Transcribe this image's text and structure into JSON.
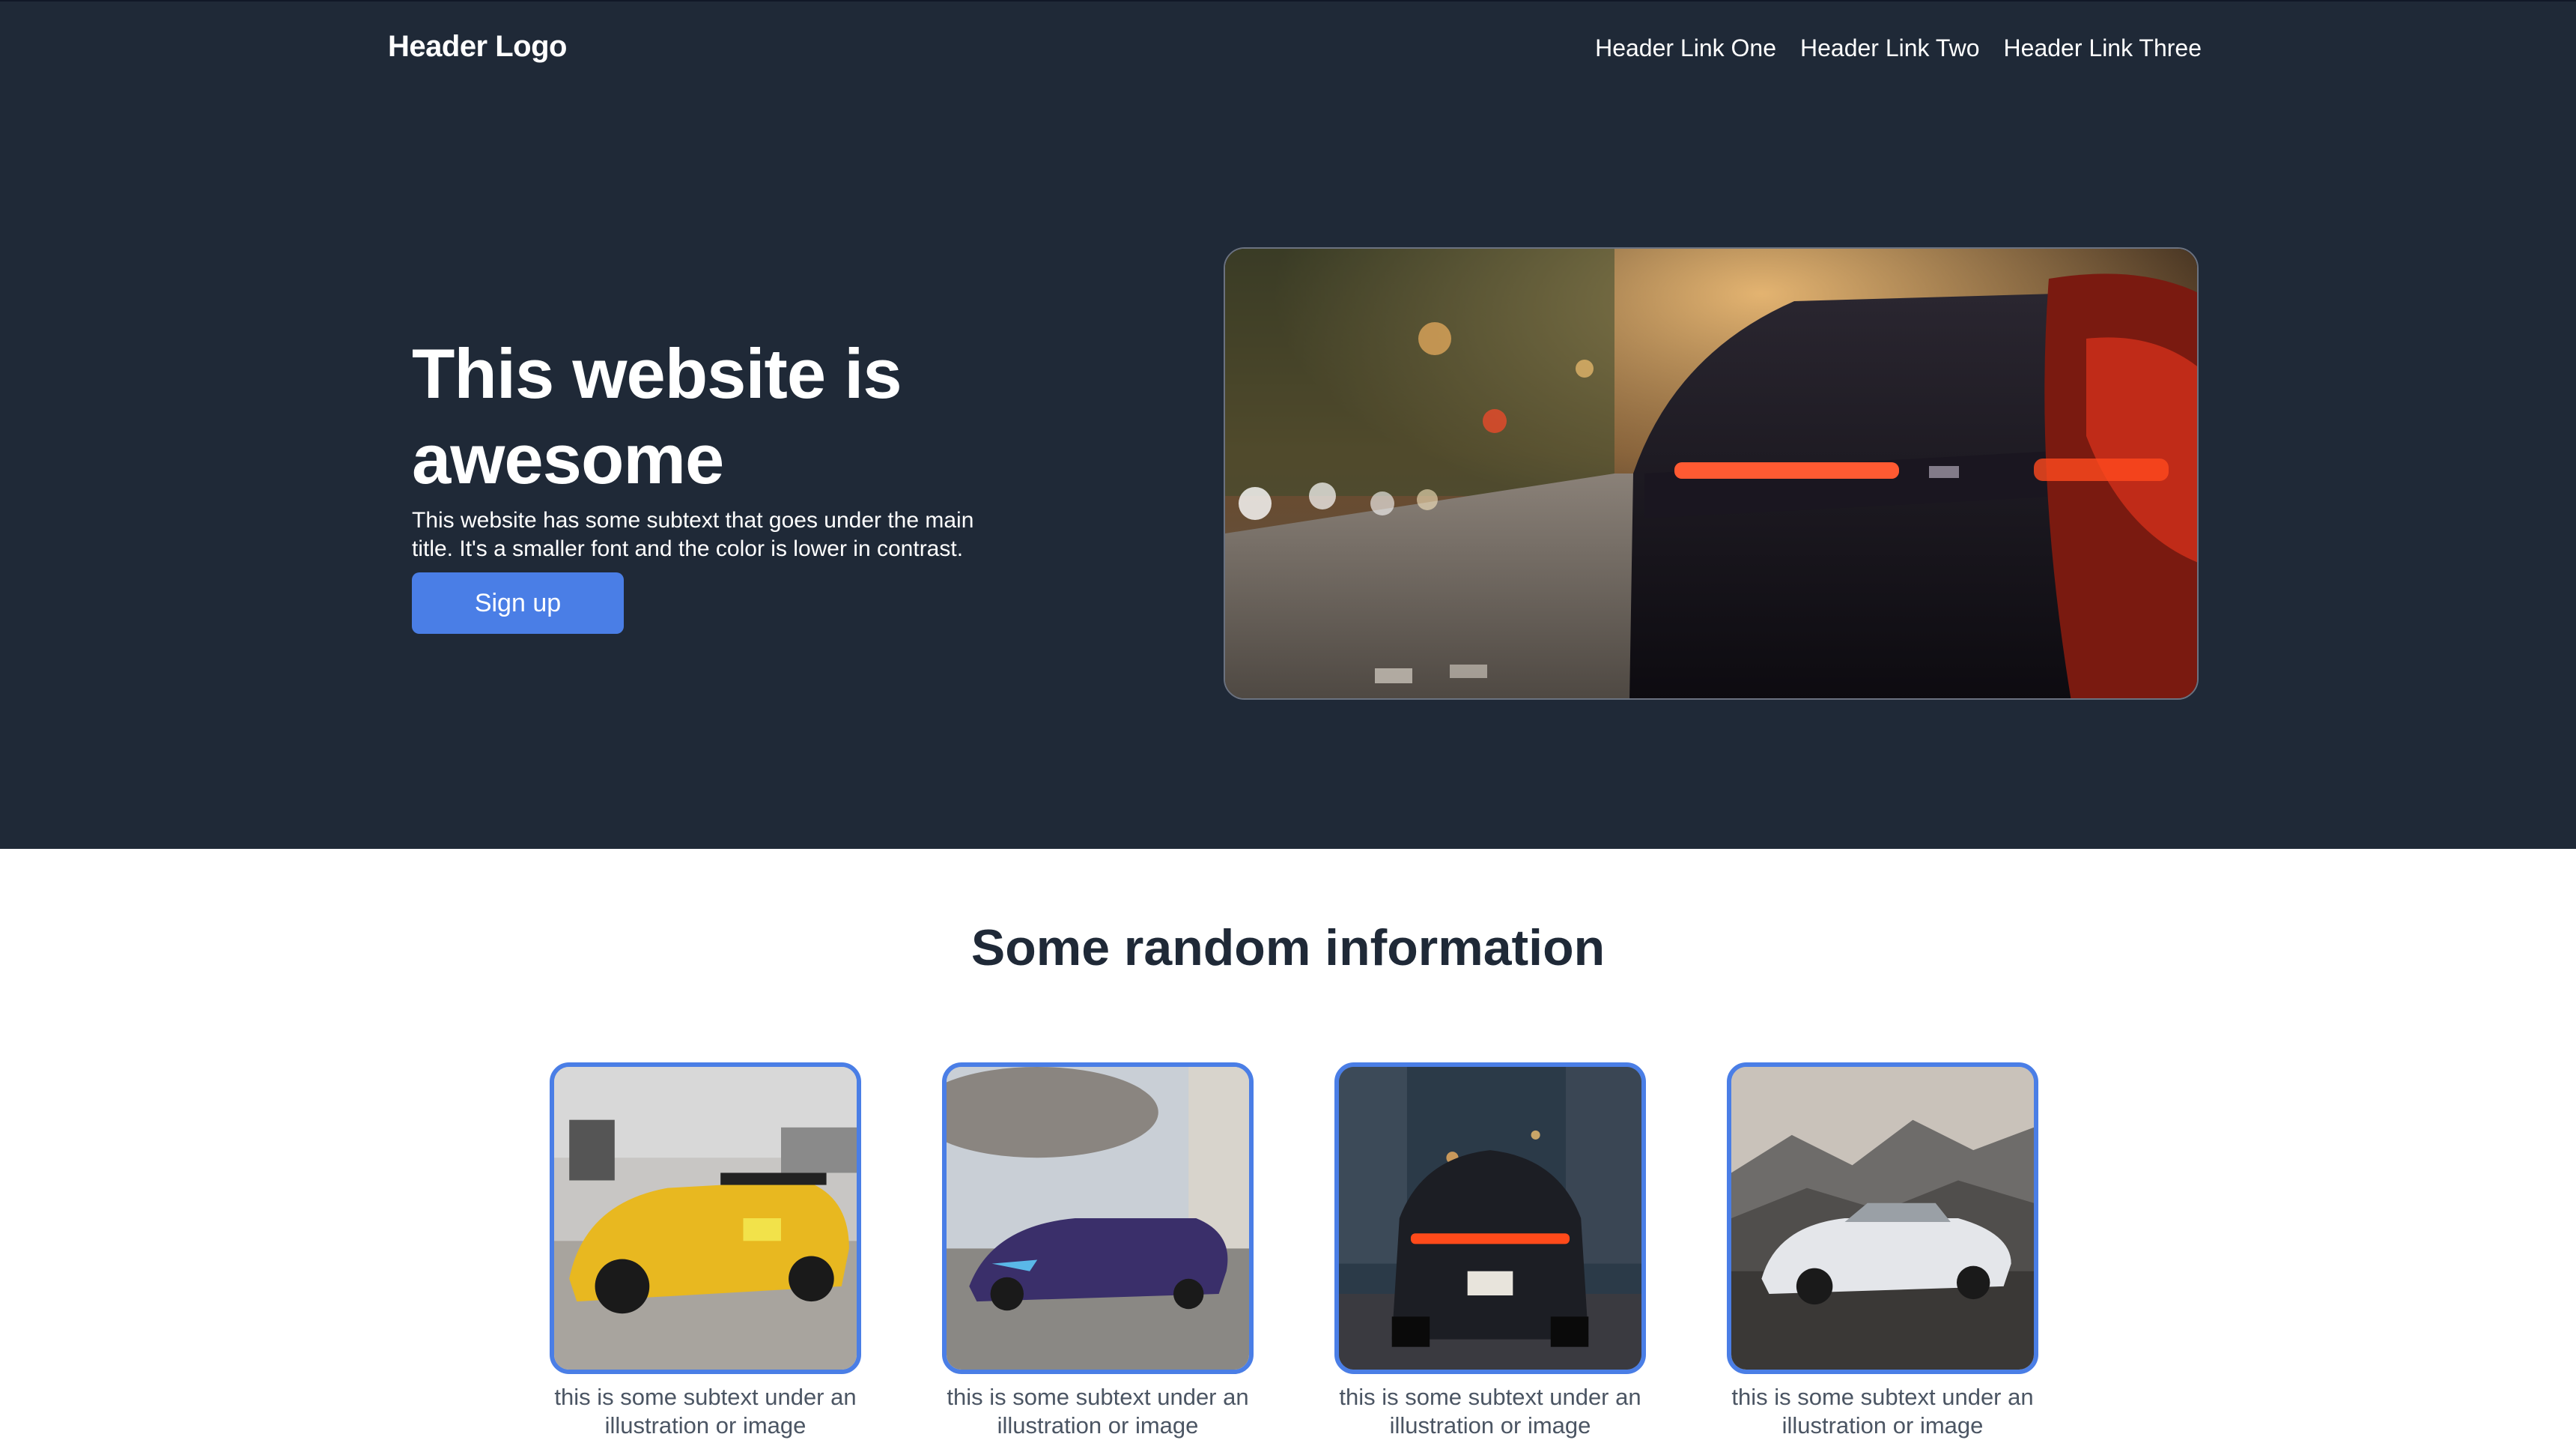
{
  "header": {
    "logo": "Header Logo",
    "links": [
      "Header Link One",
      "Header Link Two",
      "Header Link Three"
    ]
  },
  "hero": {
    "title": "This website is awesome",
    "subtitle": "This website has some subtext that goes under the main title. It's a smaller font and the color is lower in contrast.",
    "cta_label": "Sign up",
    "image_alt": "Rear of a dark sports car at dusk with glowing tail lights"
  },
  "section": {
    "title": "Some random information",
    "cards": [
      {
        "caption": "this is some subtext under an illustration or image",
        "image": "yellow sports car at car show"
      },
      {
        "caption": "this is some subtext under an illustration or image",
        "image": "purple sports car on rooftop"
      },
      {
        "caption": "this is some subtext under an illustration or image",
        "image": "rear of car on city street"
      },
      {
        "caption": "this is some subtext under an illustration or image",
        "image": "white sedan in mountains"
      }
    ]
  },
  "colors": {
    "hero_bg": "#1f2937",
    "accent": "#4a7ee6",
    "section_title": "#1f2937",
    "caption": "#4b5563"
  }
}
